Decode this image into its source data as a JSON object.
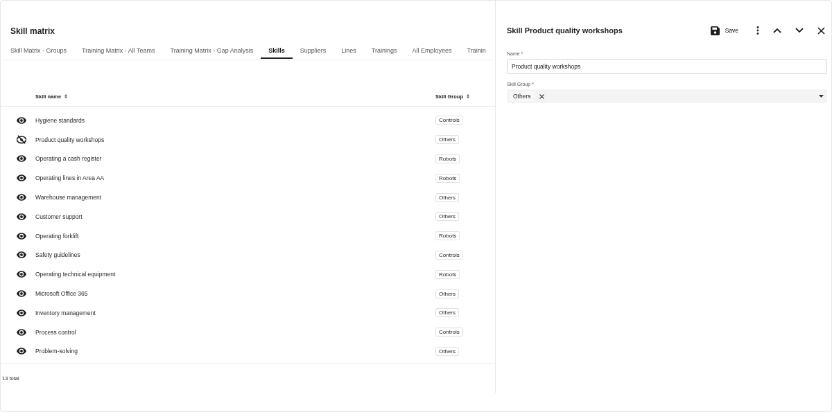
{
  "page_title": "Skill matrix",
  "tabs": [
    {
      "label": "Skill Matrix - Groups",
      "selected": false
    },
    {
      "label": "Training Matrix - All Teams",
      "selected": false
    },
    {
      "label": "Training Matrix - Gap Analysis",
      "selected": false
    },
    {
      "label": "Skills",
      "selected": true
    },
    {
      "label": "Suppliers",
      "selected": false
    },
    {
      "label": "Lines",
      "selected": false
    },
    {
      "label": "Trainings",
      "selected": false
    },
    {
      "label": "All Employees",
      "selected": false
    },
    {
      "label": "Trainin",
      "selected": false
    }
  ],
  "table": {
    "columns": [
      "Skill name",
      "Skill Group"
    ],
    "rows": [
      {
        "visible": true,
        "name": "Hygiene standards",
        "group": "Controls"
      },
      {
        "visible": false,
        "name": "Product quality workshops",
        "group": "Others"
      },
      {
        "visible": true,
        "name": "Operating a cash register",
        "group": "Robots"
      },
      {
        "visible": true,
        "name": "Operating lines in Area AA",
        "group": "Robots"
      },
      {
        "visible": true,
        "name": "Warehouse management",
        "group": "Others"
      },
      {
        "visible": true,
        "name": "Customer support",
        "group": "Others"
      },
      {
        "visible": true,
        "name": "Operating forklift",
        "group": "Robots"
      },
      {
        "visible": true,
        "name": "Safety guidelines",
        "group": "Controls"
      },
      {
        "visible": true,
        "name": "Operating technical equipment",
        "group": "Robots"
      },
      {
        "visible": true,
        "name": "Microsoft Office 365",
        "group": "Others"
      },
      {
        "visible": true,
        "name": "Inventory management",
        "group": "Others"
      },
      {
        "visible": true,
        "name": "Process control",
        "group": "Controls"
      },
      {
        "visible": true,
        "name": "Problem-solving",
        "group": "Others"
      }
    ],
    "total": "13 total"
  },
  "detail": {
    "title": "Skill Product quality workshops",
    "save_label": "Save",
    "name_label": "Name *",
    "name_value": "Product quality workshops",
    "group_label": "Skill Group *",
    "group_chips": [
      "Others"
    ]
  }
}
